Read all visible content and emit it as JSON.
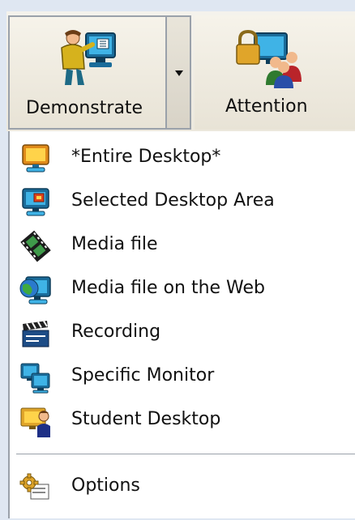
{
  "toolbar": {
    "demonstrate_label": "Demonstrate",
    "attention_label": "Attention"
  },
  "menu": {
    "items": [
      {
        "label": "*Entire Desktop*",
        "icon": "monitor-yellow-icon"
      },
      {
        "label": "Selected Desktop Area",
        "icon": "monitor-selection-icon"
      },
      {
        "label": "Media file",
        "icon": "film-strip-icon"
      },
      {
        "label": "Media file on the Web",
        "icon": "globe-monitor-icon"
      },
      {
        "label": "Recording",
        "icon": "clapperboard-icon"
      },
      {
        "label": "Specific Monitor",
        "icon": "two-monitors-icon"
      },
      {
        "label": "Student Desktop",
        "icon": "student-monitor-icon"
      }
    ],
    "options_label": "Options"
  }
}
